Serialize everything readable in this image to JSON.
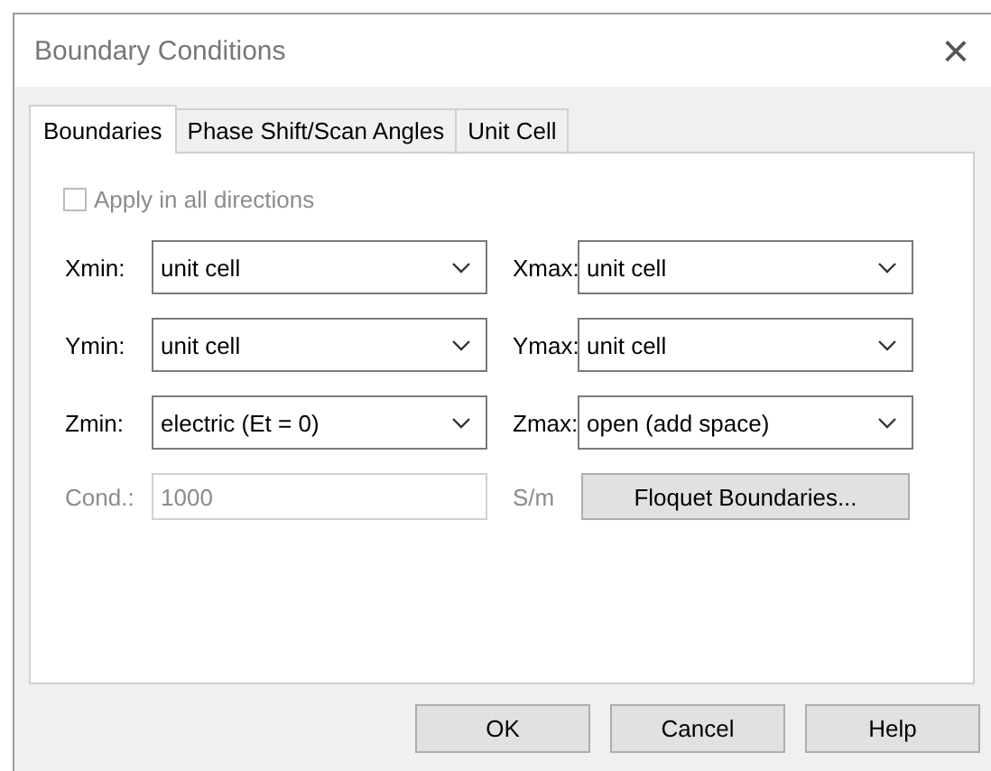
{
  "window": {
    "title": "Boundary Conditions",
    "close": "×"
  },
  "tabs": [
    {
      "label": "Boundaries",
      "selected": true
    },
    {
      "label": "Phase Shift/Scan Angles",
      "selected": false
    },
    {
      "label": "Unit Cell",
      "selected": false
    }
  ],
  "apply_all": {
    "label": "Apply in all directions",
    "checked": false,
    "disabled": true
  },
  "boundaries": [
    {
      "label": "Xmin:",
      "value": "unit cell"
    },
    {
      "label": "Xmax:",
      "value": "unit cell"
    },
    {
      "label": "Ymin:",
      "value": "unit cell"
    },
    {
      "label": "Ymax:",
      "value": "unit cell"
    },
    {
      "label": "Zmin:",
      "value": "electric (Et = 0)"
    },
    {
      "label": "Zmax:",
      "value": "open (add space)"
    }
  ],
  "conductivity": {
    "label": "Cond.:",
    "value": "1000",
    "unit": "S/m",
    "disabled": true
  },
  "floquet_button": "Floquet Boundaries...",
  "buttons": [
    "OK",
    "Cancel",
    "Help"
  ]
}
